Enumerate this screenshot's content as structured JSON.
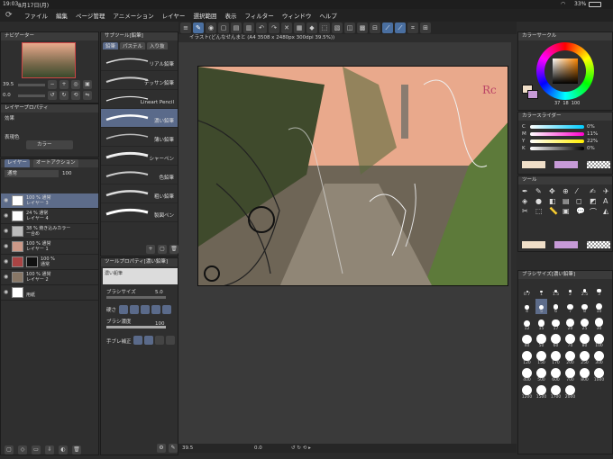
{
  "status": {
    "time": "19:03",
    "date": "8月17日(月)",
    "battery": "33%"
  },
  "menu": [
    "ファイル",
    "編集",
    "ページ管理",
    "アニメーション",
    "レイヤー",
    "選択範囲",
    "表示",
    "フィルター",
    "ウィンドウ",
    "ヘルプ"
  ],
  "navigator": {
    "title": "ナビゲーター",
    "zoom": "39.5",
    "rotation": "0.0"
  },
  "layer_property": {
    "title": "レイヤープロパティ",
    "effect_label": "効果",
    "color_label": "表現色",
    "color_value": "カラー"
  },
  "layers_panel": {
    "tabs": [
      "レイヤー",
      "オートアクション"
    ],
    "blend_mode": "通常",
    "opacity": "100",
    "layers": [
      {
        "line1": "100 % 通常",
        "line2": "レイヤー 3",
        "selected": true
      },
      {
        "line1": "24 % 通常",
        "line2": "レイヤー 4",
        "selected": false
      },
      {
        "line1": "38 % 焼き込みカラー",
        "line2": "ー合め",
        "selected": false
      },
      {
        "line1": "100 % 通常",
        "line2": "レイヤー 1",
        "selected": false
      },
      {
        "line1": "100 %",
        "line2": "通常",
        "selected": false
      },
      {
        "line1": "100 % 通常",
        "line2": "レイヤー 2",
        "selected": false
      },
      {
        "line1": "",
        "line2": "用紙",
        "selected": false
      }
    ]
  },
  "subtool": {
    "title": "サブツール[鉛筆]",
    "tabs": [
      "鉛筆",
      "パステル",
      "入り抜"
    ],
    "brushes": [
      "リアル鉛筆",
      "デッサン鉛筆",
      "Lineart Pencil",
      "濃い鉛筆",
      "薄い鉛筆",
      "シャーペン",
      "色鉛筆",
      "粗い鉛筆",
      "製図ペン"
    ]
  },
  "tool_property": {
    "title": "ツールプロパティ[濃い鉛筆]",
    "preview_label": "濃い鉛筆",
    "brush_size_label": "ブラシサイズ",
    "brush_size": "5.0",
    "hardness_label": "硬さ",
    "density_label": "ブラシ濃度",
    "density": "100",
    "stabilization_label": "手ブレ補正"
  },
  "canvas": {
    "tab_label": "イラスト(どんなせんまと (A4 3508 x 2480px 300dpi 39.5%))",
    "zoom": "39.5",
    "rotation": "0.0"
  },
  "color_wheel": {
    "title": "カラーサークル",
    "h": "37",
    "s": "18",
    "v": "100"
  },
  "color_slider": {
    "title": "カラースライダー",
    "rows": [
      {
        "label": "C",
        "value": "0%"
      },
      {
        "label": "M",
        "value": "11%"
      },
      {
        "label": "Y",
        "value": "22%"
      },
      {
        "label": "K",
        "value": "0%"
      }
    ]
  },
  "tool_panel": {
    "title": "ツール"
  },
  "brush_size_panel": {
    "title": "ブラシサイズ[濃い鉛筆]",
    "sizes": [
      "0.7",
      "1",
      "1.5",
      "2",
      "2.5",
      "3",
      "4",
      "5",
      "6",
      "7",
      "8",
      "10",
      "12",
      "15",
      "17",
      "20",
      "25",
      "30",
      "40",
      "50",
      "60",
      "70",
      "80",
      "100",
      "120",
      "150",
      "170",
      "200",
      "250",
      "300",
      "400",
      "500",
      "600",
      "700",
      "800",
      "1000",
      "1200",
      "1500",
      "1700",
      "2000"
    ]
  },
  "colors": {
    "accent": "#5d6c8a",
    "sky": "#e9a98c",
    "main_color": "#f0dfc8",
    "sub_color": "#c79ad8"
  }
}
